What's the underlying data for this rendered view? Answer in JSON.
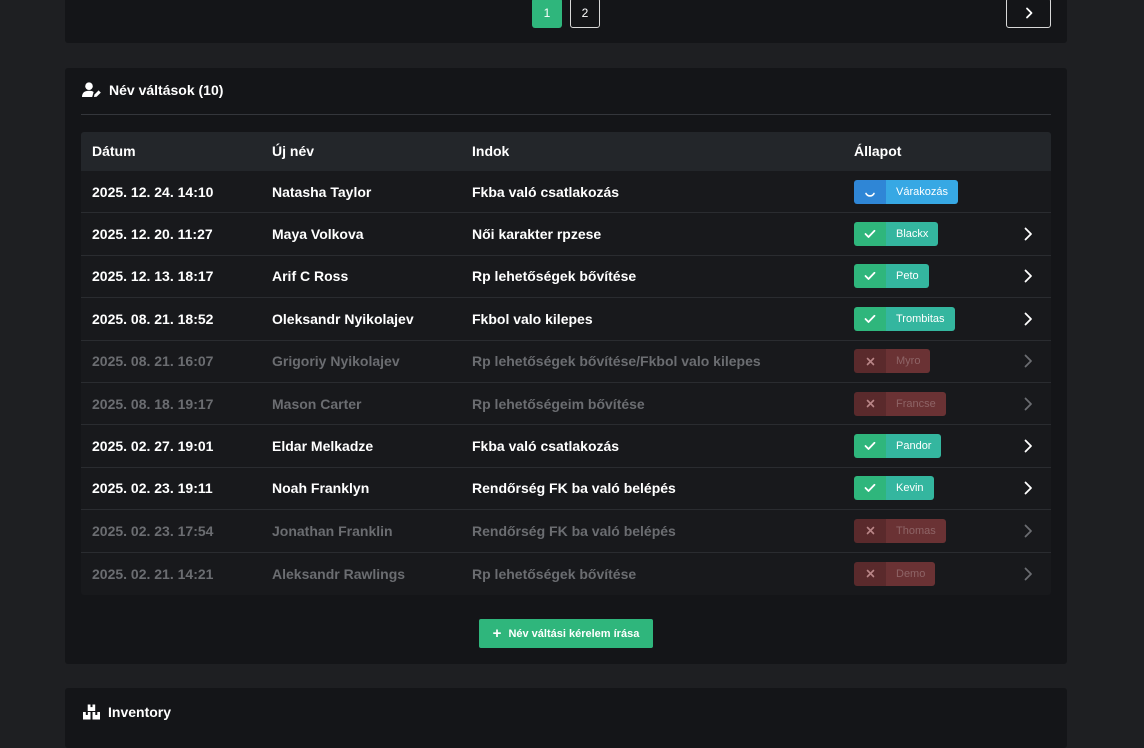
{
  "pagination": {
    "page1": "1",
    "page2": "2",
    "next_icon": "chevron-right-icon"
  },
  "name_changes": {
    "title": "Név váltások (10)",
    "icon": "user-edit-icon",
    "columns": {
      "date": "Dátum",
      "new_name": "Új név",
      "reason": "Indok",
      "status": "Állapot"
    },
    "rows": [
      {
        "date": "2025. 12. 24. 14:10",
        "new_name": "Natasha Taylor",
        "reason": "Fkba való csatlakozás",
        "status": "pending",
        "status_label": "Várakozás",
        "has_arrow": false
      },
      {
        "date": "2025. 12. 20. 11:27",
        "new_name": "Maya Volkova",
        "reason": "Női karakter rpzese",
        "status": "approved",
        "status_label": "Blackx",
        "has_arrow": true
      },
      {
        "date": "2025. 12. 13. 18:17",
        "new_name": "Arif C Ross",
        "reason": "Rp lehetőségek bővítése",
        "status": "approved",
        "status_label": "Peto",
        "has_arrow": true
      },
      {
        "date": "2025. 08. 21. 18:52",
        "new_name": "Oleksandr Nyikolajev",
        "reason": "Fkbol valo kilepes",
        "status": "approved",
        "status_label": "Trombitas",
        "has_arrow": true
      },
      {
        "date": "2025. 08. 21. 16:07",
        "new_name": "Grigoriy Nyikolajev",
        "reason": "Rp lehetőségek bővítése/Fkbol valo kilepes",
        "status": "rejected",
        "status_label": "Myro",
        "has_arrow": true
      },
      {
        "date": "2025. 08. 18. 19:17",
        "new_name": "Mason Carter",
        "reason": "Rp lehetőségeim bővítése",
        "status": "rejected",
        "status_label": "Francse",
        "has_arrow": true
      },
      {
        "date": "2025. 02. 27. 19:01",
        "new_name": "Eldar Melkadze",
        "reason": "Fkba való csatlakozás",
        "status": "approved",
        "status_label": "Pandor",
        "has_arrow": true
      },
      {
        "date": "2025. 02. 23. 19:11",
        "new_name": "Noah Franklyn",
        "reason": "Rendőrség FK ba való belépés",
        "status": "approved",
        "status_label": "Kevin",
        "has_arrow": true
      },
      {
        "date": "2025. 02. 23. 17:54",
        "new_name": "Jonathan Franklin",
        "reason": "Rendőrség FK ba való belépés",
        "status": "rejected",
        "status_label": "Thomas",
        "has_arrow": true
      },
      {
        "date": "2025. 02. 21. 14:21",
        "new_name": "Aleksandr Rawlings",
        "reason": "Rp lehetőségek bővítése",
        "status": "rejected",
        "status_label": "Demo",
        "has_arrow": true
      }
    ],
    "write_button": "Név váltási kérelem írása"
  },
  "inventory": {
    "title": "Inventory",
    "icon": "boxes-icon"
  },
  "colors": {
    "accent": "#2fb67c",
    "pending": "#37a8e4",
    "rejected": "#6a3234",
    "background": "#1e1f22",
    "card": "#141518"
  }
}
